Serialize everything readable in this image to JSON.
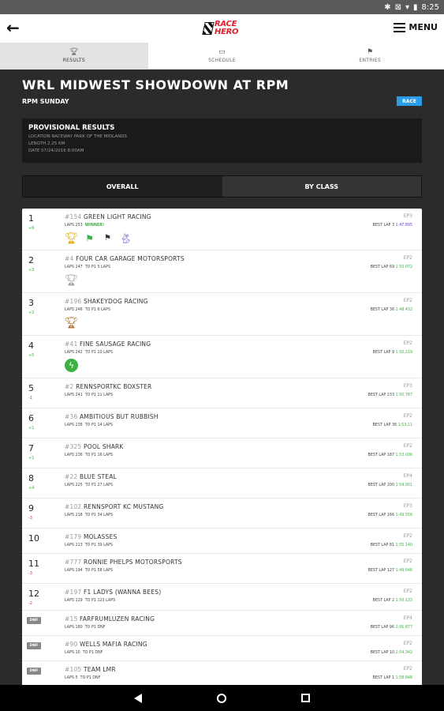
{
  "status": {
    "time": "8:25"
  },
  "appbar": {
    "logo_line1": "RACE",
    "logo_line2": "HERO",
    "menu_label": "MENU"
  },
  "tabs": [
    {
      "label": "RESULTS"
    },
    {
      "label": "SCHEDULE"
    },
    {
      "label": "ENTRIES"
    }
  ],
  "event": {
    "title": "WRL MIDWEST SHOWDOWN AT RPM",
    "subtitle": "RPM SUNDAY",
    "badge": "RACE"
  },
  "provisional": {
    "heading": "PROVISIONAL RESULTS",
    "location": "LOCATION RACEWAY PARK OF THE MIDLANDS",
    "length": "LENGTH 2.25 KM",
    "date": "DATE 07/24/2016 8:00AM"
  },
  "segments": {
    "overall": "OVERALL",
    "by_class": "BY CLASS"
  },
  "colors": {
    "accent_green": "#3cb043",
    "brand_red": "#e01e2b",
    "badge_blue": "#2a9de6",
    "purple": "#6a3fc2"
  },
  "results": [
    {
      "pos": "1",
      "delta": "+6",
      "delta_neg": false,
      "num": "#154",
      "name": "GREEN LIGHT RACING",
      "laps": "LAPS 253",
      "gap": "WINNER!",
      "winner": true,
      "cls": "EP3",
      "best_label": "BEST LAP 3",
      "best_time": "1:47.895",
      "best_purple": true,
      "awards": [
        "gold-trophy-icon",
        "green-flag-icon",
        "checkered-flag-icon",
        "rabbit-icon"
      ],
      "height": 53
    },
    {
      "pos": "2",
      "delta": "+3",
      "delta_neg": false,
      "num": "#4",
      "name": "FOUR CAR GARAGE MOTORSPORTS",
      "laps": "LAPS 247",
      "gap": "TO P1 5 LAPS",
      "winner": false,
      "cls": "EP2",
      "best_label": "BEST LAP 69",
      "best_time": "1:50.072",
      "best_purple": false,
      "awards": [
        "silver-trophy-icon"
      ],
      "height": 54
    },
    {
      "pos": "3",
      "delta": "+2",
      "delta_neg": false,
      "num": "#196",
      "name": "SHAKEYDOG RACING",
      "laps": "LAPS 246",
      "gap": "TO P1 6 LAPS",
      "winner": false,
      "cls": "EP2",
      "best_label": "BEST LAP 36",
      "best_time": "1:48.432",
      "best_purple": false,
      "awards": [
        "bronze-trophy-icon"
      ],
      "height": 54
    },
    {
      "pos": "4",
      "delta": "+5",
      "delta_neg": false,
      "num": "#41",
      "name": "FINE SAUSAGE RACING",
      "laps": "LAPS 242",
      "gap": "TO P1 10 LAPS",
      "winner": false,
      "cls": "EP2",
      "best_label": "BEST LAP 9",
      "best_time": "1:50.219",
      "best_purple": false,
      "awards": [
        "lightning-bolt-icon"
      ],
      "height": 54
    },
    {
      "pos": "5",
      "delta": "-1",
      "delta_neg": true,
      "num": "#2",
      "name": "RENNSPORTKC BOXSTER",
      "laps": "LAPS 241",
      "gap": "TO P1 11 LAPS",
      "winner": false,
      "cls": "EP3",
      "best_label": "BEST LAP 233",
      "best_time": "1:50.787",
      "best_purple": false,
      "awards": [],
      "height": 38
    },
    {
      "pos": "6",
      "delta": "+1",
      "delta_neg": false,
      "num": "#36",
      "name": "AMBITIOUS BUT RUBBISH",
      "laps": "LAPS 238",
      "gap": "TO P1 14 LAPS",
      "winner": false,
      "cls": "EP2",
      "best_label": "BEST LAP 38",
      "best_time": "1:53.11",
      "best_purple": false,
      "awards": [],
      "height": 38
    },
    {
      "pos": "7",
      "delta": "+1",
      "delta_neg": false,
      "num": "#325",
      "name": "POOL SHARK",
      "laps": "LAPS 236",
      "gap": "TO P1 16 LAPS",
      "winner": false,
      "cls": "EP2",
      "best_label": "BEST LAP 187",
      "best_time": "1:53.036",
      "best_purple": false,
      "awards": [],
      "height": 38
    },
    {
      "pos": "8",
      "delta": "+4",
      "delta_neg": false,
      "num": "#22",
      "name": "BLUE STEAL",
      "laps": "LAPS 225",
      "gap": "TO P1 27 LAPS",
      "winner": false,
      "cls": "EP4",
      "best_label": "BEST LAP 200",
      "best_time": "1:54.901",
      "best_purple": false,
      "awards": [],
      "height": 38
    },
    {
      "pos": "9",
      "delta": "-3",
      "delta_neg": true,
      "num": "#102",
      "name": "RENNSPORT KC MUSTANG",
      "laps": "LAPS 218",
      "gap": "TO P1 34 LAPS",
      "winner": false,
      "cls": "EP3",
      "best_label": "BEST LAP 166",
      "best_time": "1:49.556",
      "best_purple": false,
      "awards": [],
      "height": 38
    },
    {
      "pos": "10",
      "delta": "",
      "delta_neg": false,
      "num": "#179",
      "name": "MOLASSES",
      "laps": "LAPS 213",
      "gap": "TO P1 39 LAPS",
      "winner": false,
      "cls": "EP2",
      "best_label": "BEST LAP 81",
      "best_time": "1:55.140",
      "best_purple": false,
      "awards": [],
      "height": 32
    },
    {
      "pos": "11",
      "delta": "-3",
      "delta_neg": true,
      "num": "#777",
      "name": "RONNIE PHELPS MOTORSPORTS",
      "laps": "LAPS 194",
      "gap": "TO P1 58 LAPS",
      "winner": false,
      "cls": "EP2",
      "best_label": "BEST LAP 127",
      "best_time": "1:49.646",
      "best_purple": false,
      "awards": [],
      "height": 38
    },
    {
      "pos": "12",
      "delta": "-2",
      "delta_neg": true,
      "num": "#197",
      "name": "F1 LADYS (WANNA BEES)",
      "laps": "LAPS 129",
      "gap": "TO P1 123 LAPS",
      "winner": false,
      "cls": "EP2",
      "best_label": "BEST LAP 2",
      "best_time": "1:50.133",
      "best_purple": false,
      "awards": [],
      "height": 34
    },
    {
      "pos": "DNF",
      "delta": "",
      "delta_neg": false,
      "num": "#15",
      "name": "FARFRUMLUZEN RACING",
      "laps": "LAPS 180",
      "gap": "TO P1 DNF",
      "winner": false,
      "cls": "EP4",
      "best_label": "BEST LAP 96",
      "best_time": "2:01.877",
      "best_purple": false,
      "awards": [],
      "height": 32
    },
    {
      "pos": "DNF",
      "delta": "",
      "delta_neg": false,
      "num": "#90",
      "name": "WELLS MAFIA RACING",
      "laps": "LAPS 10",
      "gap": "TO P1 DNF",
      "winner": false,
      "cls": "EP2",
      "best_label": "BEST LAP 10",
      "best_time": "2:04.342",
      "best_purple": false,
      "awards": [],
      "height": 32
    },
    {
      "pos": "DNF",
      "delta": "",
      "delta_neg": false,
      "num": "#105",
      "name": "TEAM LMR",
      "laps": "LAPS 5",
      "gap": "TO P1 DNF",
      "winner": false,
      "cls": "EP2",
      "best_label": "BEST LAP 1",
      "best_time": "1:58.848",
      "best_purple": false,
      "awards": [],
      "height": 32
    }
  ]
}
